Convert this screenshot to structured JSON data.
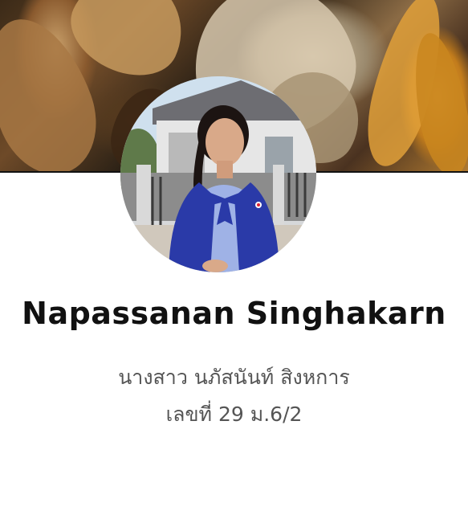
{
  "profile": {
    "name": "Napassanan Singhakarn",
    "thai_name": "นางสาว นภัสนันท์ สิงหการ",
    "class_info": "เลขที่ 29 ม.6/2"
  },
  "colors": {
    "background": "#ffffff",
    "name_text": "#111111",
    "sub_text": "#555555"
  }
}
